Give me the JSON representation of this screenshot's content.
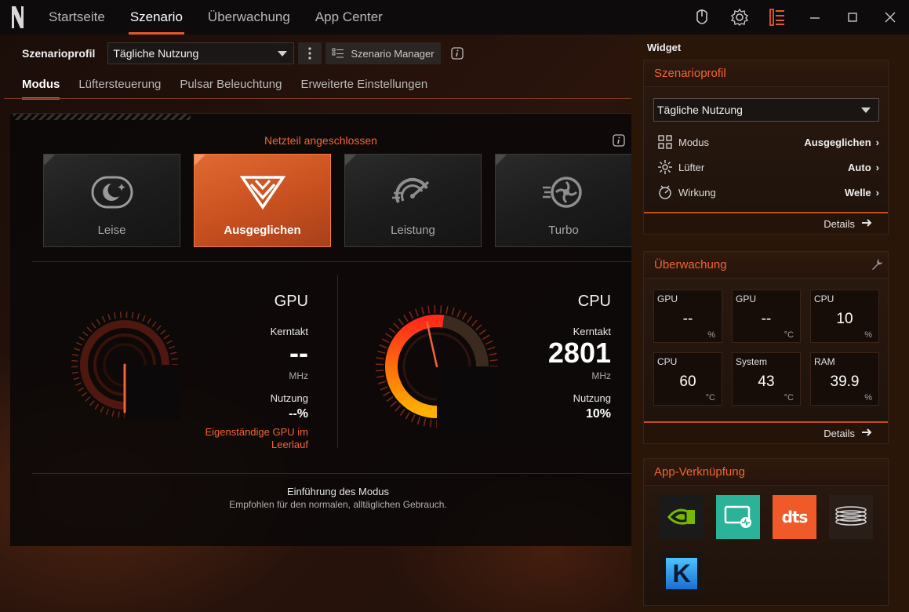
{
  "nav": {
    "tabs": [
      {
        "label": "Startseite",
        "active": false
      },
      {
        "label": "Szenario",
        "active": true
      },
      {
        "label": "Überwachung",
        "active": false
      },
      {
        "label": "App Center",
        "active": false
      }
    ]
  },
  "icons": {
    "logo": "brand-logo-icon",
    "mouse": "mouse-icon",
    "settings": "gear-icon",
    "menu": "menu-icon",
    "minimize": "minimize-icon",
    "maximize": "maximize-icon",
    "close": "close-icon"
  },
  "accent": "#e4592c",
  "scenario": {
    "profile_label": "Szenarioprofil",
    "profile_value": "Tägliche Nutzung",
    "manager_label": "Szenario Manager"
  },
  "subtabs": [
    {
      "label": "Modus",
      "active": true
    },
    {
      "label": "Lüftersteuerung",
      "active": false
    },
    {
      "label": "Pulsar Beleuchtung",
      "active": false
    },
    {
      "label": "Erweiterte Einstellungen",
      "active": false
    }
  ],
  "power_state": "Netzteil angeschlossen",
  "modes": [
    {
      "label": "Leise",
      "icon": "moon-icon",
      "active": false
    },
    {
      "label": "Ausgeglichen",
      "icon": "balanced-chevron-icon",
      "active": true
    },
    {
      "label": "Leistung",
      "icon": "speedometer-icon",
      "active": false
    },
    {
      "label": "Turbo",
      "icon": "turbo-fan-icon",
      "active": false
    }
  ],
  "gpu": {
    "title": "GPU",
    "clock_label": "Kerntakt",
    "clock_value": "--",
    "clock_unit": "MHz",
    "usage_label": "Nutzung",
    "usage_value": "--%",
    "note": "Eigenständige GPU im Leerlauf",
    "usage_fraction": 0
  },
  "cpu": {
    "title": "CPU",
    "clock_label": "Kerntakt",
    "clock_value": "2801",
    "clock_unit": "MHz",
    "usage_label": "Nutzung",
    "usage_value": "10%",
    "usage_fraction": 0.1
  },
  "mode_intro": {
    "title": "Einführung des Modus",
    "description": "Empfohlen für den normalen, alltäglichen Gebrauch."
  },
  "widget": {
    "title": "Widget",
    "profile_card": {
      "title": "Szenarioprofil",
      "select_value": "Tägliche Nutzung",
      "rows": [
        {
          "label": "Modus",
          "value": "Ausgeglichen",
          "icon": "grid-icon"
        },
        {
          "label": "Lüfter",
          "value": "Auto",
          "icon": "fan-icon"
        },
        {
          "label": "Wirkung",
          "value": "Welle",
          "icon": "effect-icon"
        }
      ],
      "details": "Details"
    },
    "monitor_card": {
      "title": "Überwachung",
      "cells": [
        {
          "name": "GPU",
          "value": "--",
          "unit": "%"
        },
        {
          "name": "GPU",
          "value": "--",
          "unit": "°C"
        },
        {
          "name": "CPU",
          "value": "10",
          "unit": "%"
        },
        {
          "name": "CPU",
          "value": "60",
          "unit": "°C"
        },
        {
          "name": "System",
          "value": "43",
          "unit": "°C"
        },
        {
          "name": "RAM",
          "value": "39.9",
          "unit": "%"
        }
      ],
      "details": "Details"
    },
    "apps_card": {
      "title": "App-Verknüpfung",
      "apps": [
        {
          "name": "nvidia-app-icon"
        },
        {
          "name": "monitor-app-icon"
        },
        {
          "name": "dts-app-icon",
          "label": "dts"
        },
        {
          "name": "coil-app-icon"
        },
        {
          "name": "killer-app-icon",
          "label": "K"
        }
      ]
    }
  }
}
